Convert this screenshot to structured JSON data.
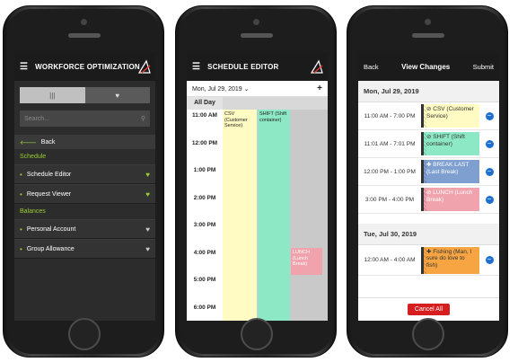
{
  "screen1": {
    "title": "WORKFORCE OPTIMIZATION",
    "tabs": [
      "|||",
      "♥"
    ],
    "search_placeholder": "Search...",
    "back_label": "Back",
    "section_schedule": "Schedule",
    "schedule_items": [
      {
        "label": "Schedule Editor",
        "heart_color": "#9acd32"
      },
      {
        "label": "Request Viewer",
        "heart_color": "#9acd32"
      }
    ],
    "section_balances": "Balances",
    "balance_items": [
      {
        "label": "Personal Account",
        "heart_color": "#c8c8c8"
      },
      {
        "label": "Group Allowance",
        "heart_color": "#c8c8c8"
      }
    ]
  },
  "screen2": {
    "title": "SCHEDULE EDITOR",
    "date": "Mon, Jul 29, 2019",
    "add": "+",
    "allday": "All Day",
    "times": [
      "11:00 AM",
      "12:00 PM",
      "1:00 PM",
      "2:00 PM",
      "3:00 PM",
      "4:00 PM",
      "5:00 PM",
      "6:00 PM"
    ],
    "events": [
      {
        "text": "CSV (Customer Service)",
        "color": "#fffbc2"
      },
      {
        "text": "SHIFT (Shift container)",
        "color": "#8de8c5"
      },
      {
        "text": "LUNCH (Lunch Break)",
        "color": "#f0a3ad"
      }
    ]
  },
  "screen3": {
    "back": "Back",
    "title": "View Changes",
    "submit": "Submit",
    "day1": "Mon, Jul 29, 2019",
    "day1_changes": [
      {
        "time": "11:00 AM - 7:00 PM",
        "text": "⊘ CSV (Customer Service)",
        "color": "#fffbc2"
      },
      {
        "time": "11:01 AM - 7:01 PM",
        "text": "⊘ SHIFT (Shift container)",
        "color": "#8de8c5"
      },
      {
        "time": "12:00 PM - 1:00 PM",
        "text": "✚ BREAK LAST (Last Break)",
        "color": "#7f9fd0"
      },
      {
        "time": "3:00 PM - 4:00 PM",
        "text": "⊘ LUNCH (Lunch Break)",
        "color": "#f0a3ad"
      }
    ],
    "day2": "Tue, Jul 30, 2019",
    "day2_changes": [
      {
        "time": "12:00 AM - 4:00 AM",
        "text": "✚ Fishing (Man, I sure do love to fish)",
        "color": "#f7a543"
      }
    ],
    "cancel": "Cancel All"
  }
}
